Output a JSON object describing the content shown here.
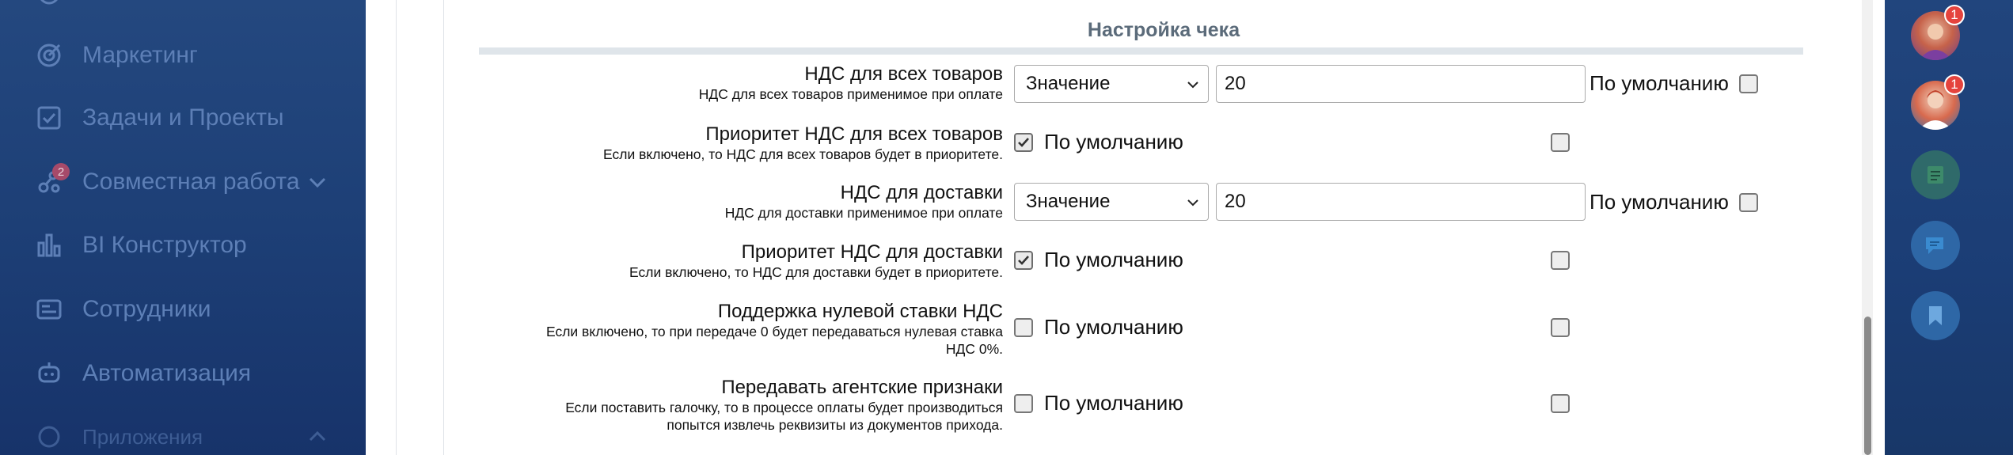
{
  "sidebar": {
    "items": [
      {
        "label": "Маркетинг",
        "icon": "target-icon"
      },
      {
        "label": "Задачи и Проекты",
        "icon": "checkbox-icon"
      },
      {
        "label": "Совместная работа",
        "icon": "collaboration-icon",
        "badge": "2"
      },
      {
        "label": "BI Конструктор",
        "icon": "bar-chart-icon"
      },
      {
        "label": "Сотрудники",
        "icon": "id-card-icon"
      },
      {
        "label": "Автоматизация",
        "icon": "robot-icon"
      },
      {
        "label": "Приложения",
        "icon": "apps-icon"
      }
    ]
  },
  "section": {
    "title": "Настройка чека"
  },
  "rows": [
    {
      "label": "НДС для всех товаров",
      "hint": "НДС для всех товаров применимое при оплате",
      "select_value": "Значение",
      "input_value": "20",
      "default_label": "По умолчанию"
    },
    {
      "label": "Приоритет НДС для всех товаров",
      "hint": "Если включено, то НДС для всех товаров будет в приоритете.",
      "checked": true,
      "default_label": "По умолчанию"
    },
    {
      "label": "НДС для доставки",
      "hint": "НДС для доставки применимое при оплате",
      "select_value": "Значение",
      "input_value": "20",
      "default_label": "По умолчанию"
    },
    {
      "label": "Приоритет НДС для доставки",
      "hint": "Если включено, то НДС для доставки будет в приоритете.",
      "checked": true,
      "default_label": "По умолчанию"
    },
    {
      "label": "Поддержка нулевой ставки НДС",
      "hint_line1": "Если включено, то при передаче 0 будет передаваться нулевая ставка",
      "hint_line2": "НДС 0%.",
      "checked": false,
      "default_label": "По умолчанию"
    },
    {
      "label": "Передавать агентские признаки",
      "hint_line1": "Если поставить галочку, то в процессе оплаты будет производиться",
      "hint_line2": "попытся извлечь реквизиты из документов прихода.",
      "checked": false,
      "default_label": "По умолчанию"
    }
  ],
  "right_panel": {
    "notifications": [
      {
        "badge": "1",
        "icon": "avatar-user-1"
      },
      {
        "badge": "1",
        "icon": "avatar-user-2"
      }
    ],
    "buttons": [
      {
        "icon": "notes-icon",
        "color": "#3d8a6a"
      },
      {
        "icon": "chat-icon",
        "color": "#3a8bd0"
      },
      {
        "icon": "bookmark-icon",
        "color": "#3a8bd0"
      }
    ]
  }
}
